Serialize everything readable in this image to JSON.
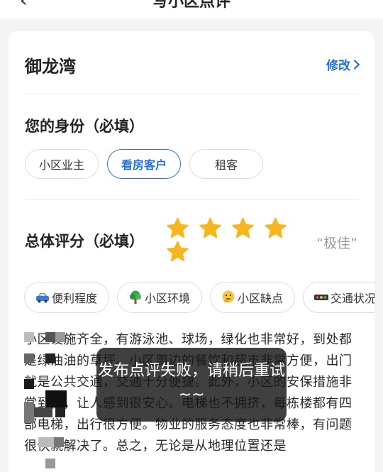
{
  "topbar": {
    "back_icon": "‹",
    "title": "写小区点评"
  },
  "community": {
    "name": "御龙湾",
    "edit_label": "修改"
  },
  "identity": {
    "title": "您的身份（必填）",
    "options": [
      "小区业主",
      "看房客户",
      "租客"
    ],
    "selected": "看房客户"
  },
  "rating": {
    "title": "总体评分（必填）",
    "stars": 5,
    "max_stars": 5,
    "star_color": "#f5b61e",
    "label": "“极佳”"
  },
  "tags": [
    {
      "icon": "car-icon",
      "label": "便利程度"
    },
    {
      "icon": "tree-icon",
      "label": "小区环境"
    },
    {
      "icon": "thinking-face-icon",
      "label": "小区缺点"
    },
    {
      "icon": "traffic-light-icon",
      "label": "交通状况"
    }
  ],
  "review_text": "小区设施齐全，有游泳池、球场，绿化也非常好，到处都是绿油油的草坪。小区周边的餐饮和超市非常方便，出门就是公共交通，交通十分便捷。此外，小区的安保措施非常到位，让人感到很安心。电梯也不拥挤，每栋楼都有四部电梯，出行很方便。物业的服务态度也非常棒，有问题很快就解决了。总之，无论是从地理位置还是",
  "toast": "发布点评失败，请稍后重试~~",
  "colors": {
    "accent": "#1f6fdc",
    "background": "#f3f4f6",
    "toast_bg": "#161616"
  }
}
